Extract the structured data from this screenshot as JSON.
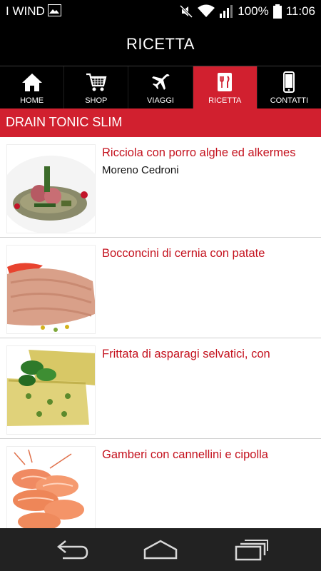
{
  "status_bar": {
    "carrier": "I WIND",
    "battery": "100%",
    "time": "11:06"
  },
  "header": {
    "title": "RICETTA"
  },
  "nav": {
    "tabs": [
      {
        "label": "HOME",
        "icon": "home-icon",
        "active": false
      },
      {
        "label": "SHOP",
        "icon": "cart-icon",
        "active": false
      },
      {
        "label": "VIAGGI",
        "icon": "airplane-icon",
        "active": false
      },
      {
        "label": "RICETTA",
        "icon": "recipe-icon",
        "active": true
      },
      {
        "label": "CONTATTI",
        "icon": "phone-icon",
        "active": false
      }
    ]
  },
  "section": {
    "title": "DRAIN TONIC SLIM"
  },
  "recipes": [
    {
      "title": "Ricciola con porro alghe ed alkermes",
      "author": "Moreno Cedroni"
    },
    {
      "title": "Bocconcini di cernia con patate",
      "author": ""
    },
    {
      "title": "Frittata di asparagi selvatici, con",
      "author": ""
    },
    {
      "title": "Gamberi con cannellini e cipolla",
      "author": ""
    }
  ],
  "colors": {
    "accent": "#d1202f",
    "title_red": "#c4121e",
    "bar_black": "#000000",
    "sys_nav": "#222222"
  }
}
